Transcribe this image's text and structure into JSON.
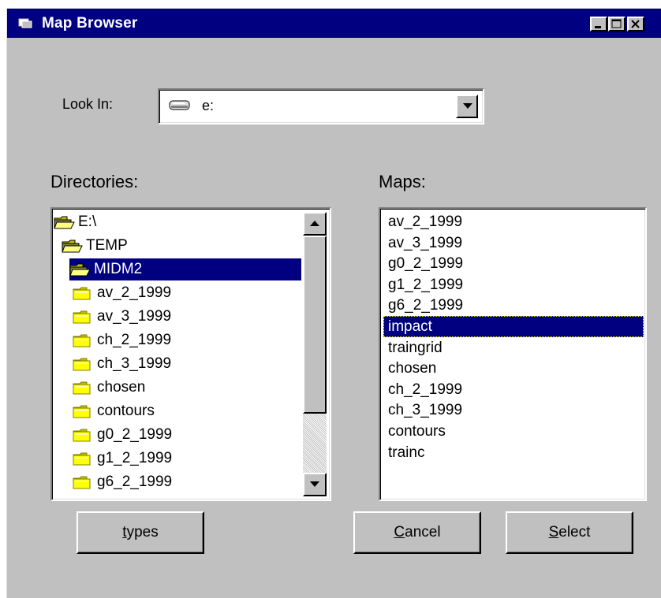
{
  "window": {
    "title": "Map Browser",
    "minimize_icon": "minimize-icon",
    "maximize_icon": "maximize-icon",
    "close_icon": "close-icon"
  },
  "look_in": {
    "label": "Look In:",
    "value": "e:",
    "icon": "drive-icon"
  },
  "directories": {
    "label": "Directories:",
    "items": [
      {
        "label": "E:\\",
        "icon": "open-folder-icon",
        "level": 0,
        "selected": false
      },
      {
        "label": "TEMP",
        "icon": "open-folder-icon",
        "level": 1,
        "selected": false
      },
      {
        "label": "MIDM2",
        "icon": "open-folder-icon",
        "level": 2,
        "selected": true
      },
      {
        "label": "av_2_1999",
        "icon": "folder-icon",
        "level": 3,
        "selected": false
      },
      {
        "label": "av_3_1999",
        "icon": "folder-icon",
        "level": 3,
        "selected": false
      },
      {
        "label": "ch_2_1999",
        "icon": "folder-icon",
        "level": 3,
        "selected": false
      },
      {
        "label": "ch_3_1999",
        "icon": "folder-icon",
        "level": 3,
        "selected": false
      },
      {
        "label": "chosen",
        "icon": "folder-icon",
        "level": 3,
        "selected": false
      },
      {
        "label": "contours",
        "icon": "folder-icon",
        "level": 3,
        "selected": false
      },
      {
        "label": "g0_2_1999",
        "icon": "folder-icon",
        "level": 3,
        "selected": false
      },
      {
        "label": "g1_2_1999",
        "icon": "folder-icon",
        "level": 3,
        "selected": false
      },
      {
        "label": "g6_2_1999",
        "icon": "folder-icon",
        "level": 3,
        "selected": false
      }
    ]
  },
  "maps": {
    "label": "Maps:",
    "items": [
      {
        "label": "av_2_1999",
        "selected": false
      },
      {
        "label": "av_3_1999",
        "selected": false
      },
      {
        "label": "g0_2_1999",
        "selected": false
      },
      {
        "label": "g1_2_1999",
        "selected": false
      },
      {
        "label": "g6_2_1999",
        "selected": false
      },
      {
        "label": "impact",
        "selected": true
      },
      {
        "label": "traingrid",
        "selected": false
      },
      {
        "label": "chosen",
        "selected": false
      },
      {
        "label": "ch_2_1999",
        "selected": false
      },
      {
        "label": "ch_3_1999",
        "selected": false
      },
      {
        "label": "contours",
        "selected": false
      },
      {
        "label": "trainc",
        "selected": false
      }
    ]
  },
  "buttons": {
    "types": {
      "label": "types",
      "mnemonic": "t"
    },
    "cancel": {
      "label": "Cancel",
      "mnemonic": "C"
    },
    "select": {
      "label": "Select",
      "mnemonic": "S"
    }
  },
  "colors": {
    "titlebar": "#000080",
    "face": "#c0c0c0",
    "selection": "#000080",
    "folder": "#ffff00"
  }
}
